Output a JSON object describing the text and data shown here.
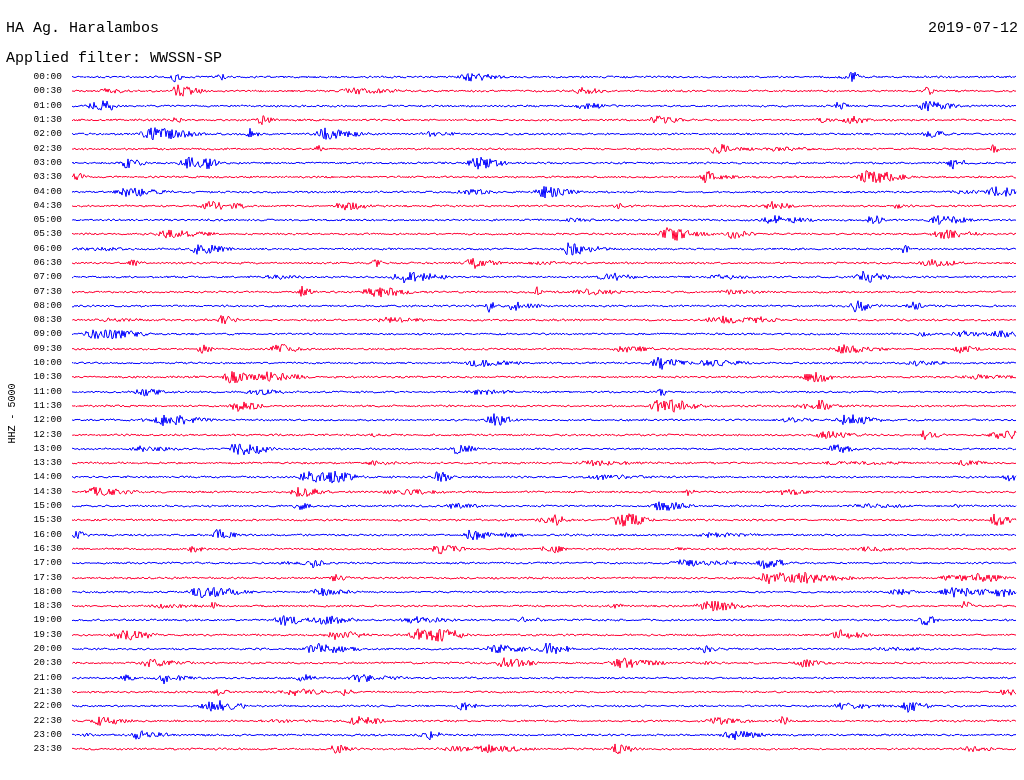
{
  "header": {
    "station": "HA Ag. Haralambos",
    "date": "2019-07-12",
    "filter": "Applied filter: WWSSN-SP"
  },
  "axis_label": "HHZ - 5000",
  "rows": [
    {
      "time": "00:00",
      "color": "#0000ff"
    },
    {
      "time": "00:30",
      "color": "#ff0033"
    },
    {
      "time": "01:00",
      "color": "#0000ff"
    },
    {
      "time": "01:30",
      "color": "#ff0033"
    },
    {
      "time": "02:00",
      "color": "#0000ff"
    },
    {
      "time": "02:30",
      "color": "#ff0033"
    },
    {
      "time": "03:00",
      "color": "#0000ff"
    },
    {
      "time": "03:30",
      "color": "#ff0033"
    },
    {
      "time": "04:00",
      "color": "#0000ff"
    },
    {
      "time": "04:30",
      "color": "#ff0033"
    },
    {
      "time": "05:00",
      "color": "#0000ff"
    },
    {
      "time": "05:30",
      "color": "#ff0033"
    },
    {
      "time": "06:00",
      "color": "#0000ff"
    },
    {
      "time": "06:30",
      "color": "#ff0033"
    },
    {
      "time": "07:00",
      "color": "#0000ff"
    },
    {
      "time": "07:30",
      "color": "#ff0033"
    },
    {
      "time": "08:00",
      "color": "#0000ff"
    },
    {
      "time": "08:30",
      "color": "#ff0033"
    },
    {
      "time": "09:00",
      "color": "#0000ff"
    },
    {
      "time": "09:30",
      "color": "#ff0033"
    },
    {
      "time": "10:00",
      "color": "#0000ff"
    },
    {
      "time": "10:30",
      "color": "#ff0033"
    },
    {
      "time": "11:00",
      "color": "#0000ff"
    },
    {
      "time": "11:30",
      "color": "#ff0033"
    },
    {
      "time": "12:00",
      "color": "#0000ff"
    },
    {
      "time": "12:30",
      "color": "#ff0033"
    },
    {
      "time": "13:00",
      "color": "#0000ff"
    },
    {
      "time": "13:30",
      "color": "#ff0033"
    },
    {
      "time": "14:00",
      "color": "#0000ff"
    },
    {
      "time": "14:30",
      "color": "#ff0033"
    },
    {
      "time": "15:00",
      "color": "#0000ff"
    },
    {
      "time": "15:30",
      "color": "#ff0033"
    },
    {
      "time": "16:00",
      "color": "#0000ff"
    },
    {
      "time": "16:30",
      "color": "#ff0033"
    },
    {
      "time": "17:00",
      "color": "#0000ff"
    },
    {
      "time": "17:30",
      "color": "#ff0033"
    },
    {
      "time": "18:00",
      "color": "#0000ff"
    },
    {
      "time": "18:30",
      "color": "#ff0033"
    },
    {
      "time": "19:00",
      "color": "#0000ff"
    },
    {
      "time": "19:30",
      "color": "#ff0033"
    },
    {
      "time": "20:00",
      "color": "#0000ff"
    },
    {
      "time": "20:30",
      "color": "#ff0033"
    },
    {
      "time": "21:00",
      "color": "#0000ff"
    },
    {
      "time": "21:30",
      "color": "#ff0033"
    },
    {
      "time": "22:00",
      "color": "#0000ff"
    },
    {
      "time": "22:30",
      "color": "#ff0033"
    },
    {
      "time": "23:00",
      "color": "#0000ff"
    },
    {
      "time": "23:30",
      "color": "#ff0033"
    }
  ]
}
